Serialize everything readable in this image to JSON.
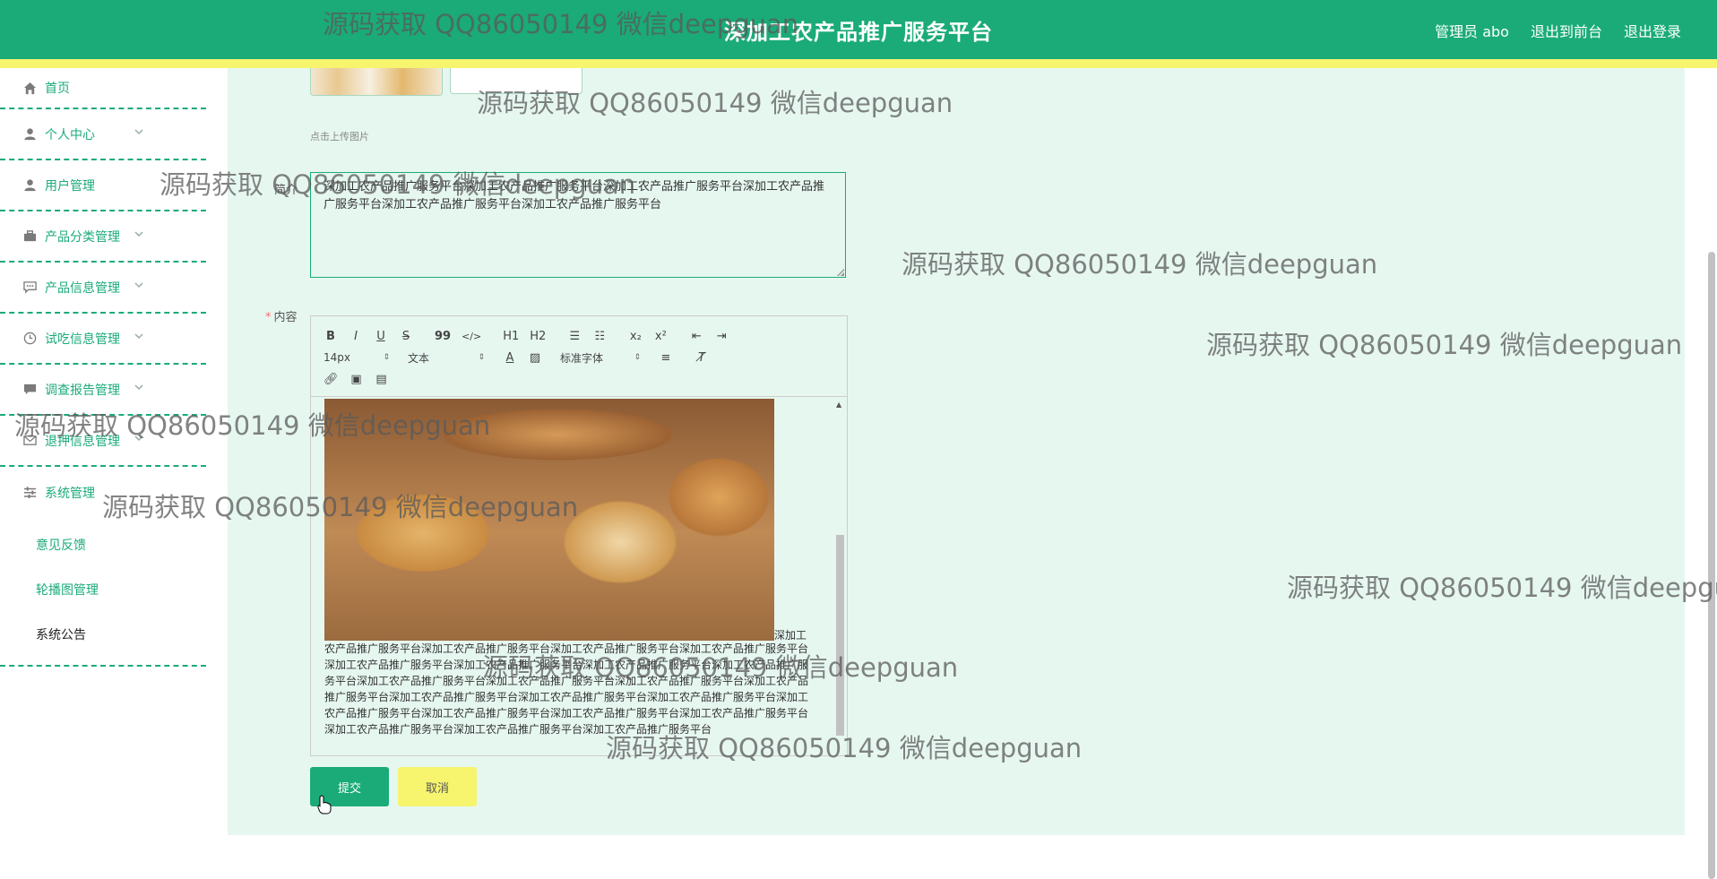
{
  "header": {
    "title": "深加工农产品推广服务平台",
    "admin": "管理员 abo",
    "to_front": "退出到前台",
    "logout": "退出登录"
  },
  "sidebar": {
    "items": [
      {
        "label": "首页",
        "icon": "home-icon"
      },
      {
        "label": "个人中心",
        "icon": "user-icon"
      },
      {
        "label": "用户管理",
        "icon": "user-icon"
      },
      {
        "label": "产品分类管理",
        "icon": "briefcase-icon"
      },
      {
        "label": "产品信息管理",
        "icon": "chat-icon"
      },
      {
        "label": "试吃信息管理",
        "icon": "clock-icon"
      },
      {
        "label": "调查报告管理",
        "icon": "message-icon"
      },
      {
        "label": "退押信息管理",
        "icon": "mail-icon"
      },
      {
        "label": "系统管理",
        "icon": "sliders-icon"
      }
    ],
    "submenu": [
      "意见反馈",
      "轮播图管理",
      "系统公告"
    ]
  },
  "form": {
    "upload_hint": "点击上传图片",
    "summary_label": "简介",
    "summary_value": "深加工农产品推广服务平台深加工农产品推广服务平台深加工农产品推广服务平台深加工农产品推广服务平台深加工农产品推广服务平台深加工农产品推广服务平台",
    "content_label": "内容",
    "toolbar": {
      "bold": "B",
      "italic": "I",
      "underline": "U",
      "strike": "S",
      "quote": "99",
      "code": "</>",
      "h1": "H1",
      "h2": "H2",
      "sub": "x₂",
      "sup": "x²",
      "font_size": "14px",
      "text_type": "文本",
      "font_family": "标准字体"
    },
    "image_caption": "深加工",
    "content_text": "农产品推广服务平台深加工农产品推广服务平台深加工农产品推广服务平台深加工农产品推广服务平台深加工农产品推广服务平台深加工农产品推广服务平台深加工农产品推广服务平台深加工农产品推广服务平台深加工农产品推广服务平台深加工农产品推广服务平台深加工农产品推广服务平台深加工农产品推广服务平台深加工农产品推广服务平台深加工农产品推广服务平台深加工农产品推广服务平台深加工农产品推广服务平台深加工农产品推广服务平台深加工农产品推广服务平台深加工农产品推广服务平台深加工农产品推广服务平台深加工农产品推广服务平台深加工农产品推广服务平台",
    "submit": "提交",
    "cancel": "取消"
  },
  "watermark": "源码获取 QQ86050149 微信deepguan",
  "colors": {
    "primary": "#1aab78",
    "accent": "#f7f46e",
    "background": "#e6f7f0"
  }
}
